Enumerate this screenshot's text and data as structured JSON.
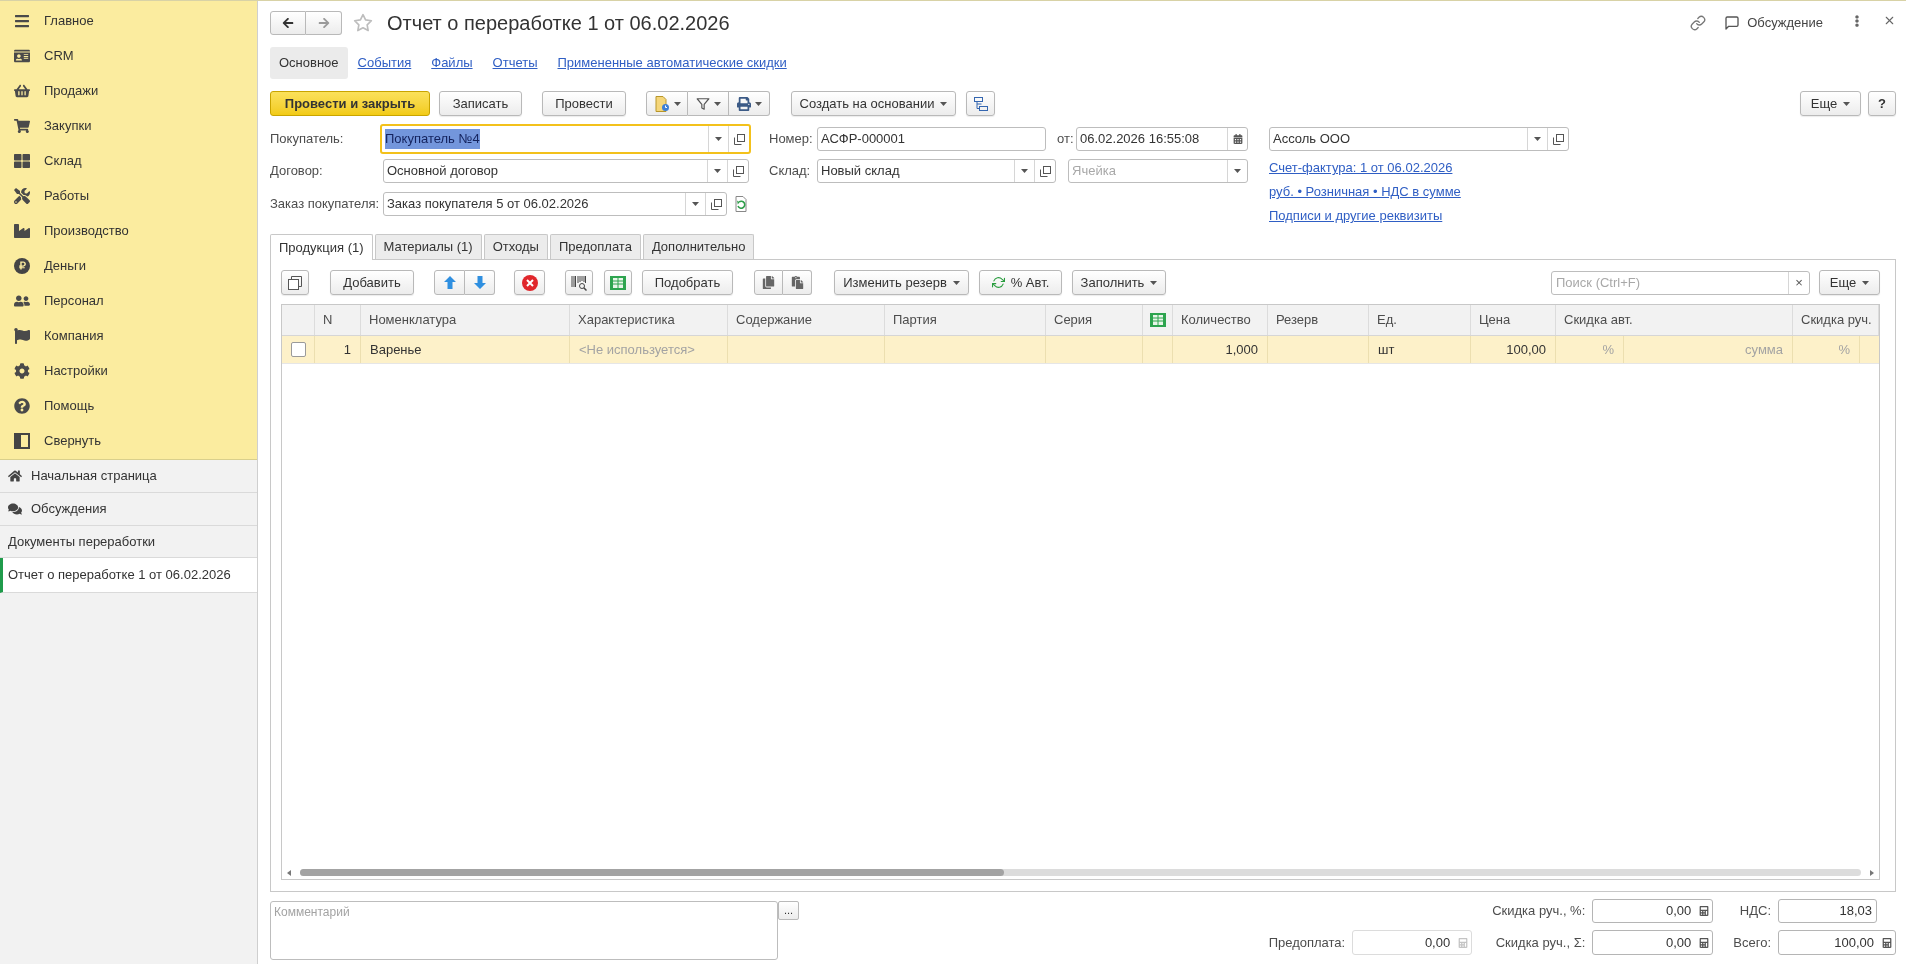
{
  "sidebar": {
    "sections": [
      {
        "label": "Главное"
      },
      {
        "label": "CRM"
      },
      {
        "label": "Продажи"
      },
      {
        "label": "Закупки"
      },
      {
        "label": "Склад"
      },
      {
        "label": "Работы"
      },
      {
        "label": "Производство"
      },
      {
        "label": "Деньги"
      },
      {
        "label": "Персонал"
      },
      {
        "label": "Компания"
      },
      {
        "label": "Настройки"
      },
      {
        "label": "Помощь"
      },
      {
        "label": "Свернуть"
      }
    ],
    "shortcuts": [
      {
        "label": "Начальная страница"
      },
      {
        "label": "Обсуждения"
      }
    ],
    "open_windows": {
      "title": "Документы переработки",
      "items": [
        {
          "label": "Отчет о переработке 1 от 06.02.2026",
          "selected": true
        }
      ]
    }
  },
  "window": {
    "title": "Отчет о переработке 1 от 06.02.2026",
    "favorite": false,
    "discussion": "Обсуждение"
  },
  "form_tabs": [
    {
      "label": "Основное",
      "selected": true
    },
    {
      "label": "События",
      "selected": false
    },
    {
      "label": "Файлы",
      "selected": false
    },
    {
      "label": "Отчеты",
      "selected": false
    },
    {
      "label": "Примененные автоматические скидки",
      "selected": false
    }
  ],
  "toolbar": {
    "post_and_close": "Провести и закрыть",
    "save": "Записать",
    "post": "Провести",
    "create_based_on": "Создать на основании",
    "more": "Еще",
    "help": "?"
  },
  "header_fields": {
    "buyer": {
      "label": "Покупатель:",
      "value": "Покупатель №4",
      "focused": true
    },
    "contract": {
      "label": "Договор:",
      "value": "Основной договор",
      "focused": false
    },
    "customer_order": {
      "label": "Заказ покупателя:",
      "value": "Заказ покупателя 5 от 06.02.2026",
      "focused": false
    },
    "number": {
      "label": "Номер:",
      "value": "АСФР-000001",
      "focused": false
    },
    "date": {
      "label": "от:",
      "value": "06.02.2026 16:55:08",
      "focused": false
    },
    "warehouse": {
      "label": "Склад:",
      "value": "Новый склад",
      "focused": false
    },
    "cell": {
      "placeholder": "Ячейка",
      "focused": false
    },
    "organization": {
      "value": "Ассоль ООО",
      "focused": false
    }
  },
  "links": [
    {
      "text": "Счет-фактура: 1 от 06.02.2026"
    },
    {
      "text": "руб. • Розничная • НДС в сумме"
    },
    {
      "text": "Подписи и другие реквизиты"
    }
  ],
  "table_tabs": [
    {
      "label": "Продукция (1)",
      "selected": true
    },
    {
      "label": "Материалы (1)",
      "selected": false
    },
    {
      "label": "Отходы",
      "selected": false
    },
    {
      "label": "Предоплата",
      "selected": false
    },
    {
      "label": "Дополнительно",
      "selected": false
    }
  ],
  "table_toolbar": {
    "add": "Добавить",
    "pick": "Подобрать",
    "change_reserve": "Изменить резерв",
    "auto_discounts": "% Авт.",
    "fill": "Заполнить",
    "search": {
      "placeholder": "Поиск (Ctrl+F)",
      "clear": "×"
    },
    "more": "Еще"
  },
  "table": {
    "columns": [
      {
        "kind": "check"
      },
      {
        "kind": "text",
        "label": "N"
      },
      {
        "kind": "text",
        "label": "Номенклатура"
      },
      {
        "kind": "text",
        "label": "Характеристика"
      },
      {
        "kind": "text",
        "label": "Содержание"
      },
      {
        "kind": "text",
        "label": "Партия"
      },
      {
        "kind": "text",
        "label": "Серия"
      },
      {
        "kind": "icon"
      },
      {
        "kind": "text",
        "label": "Количество"
      },
      {
        "kind": "text",
        "label": "Резерв"
      },
      {
        "kind": "text",
        "label": "Ед."
      },
      {
        "kind": "text",
        "label": "Цена"
      },
      {
        "kind": "text",
        "label": "Скидка авт."
      },
      {
        "kind": "text",
        "label": "Скидка руч."
      }
    ],
    "rows": [
      {
        "selected": true,
        "checked": false,
        "n": "1",
        "item": "Варенье",
        "characteristic": "<Не используется>",
        "quantity": "1,000",
        "unit": "шт",
        "price": "100,00",
        "auto_discount_percent": "%",
        "auto_discount_amount": "сумма",
        "manual_discount_percent": "%"
      }
    ]
  },
  "footer": {
    "comment": {
      "placeholder": "Комментарий",
      "more": "..."
    },
    "totals": [
      {
        "label": "Скидка руч., %:",
        "value": "0,00",
        "kind": "input",
        "disabled": false
      },
      {
        "label": "НДС:",
        "value": "18,03",
        "kind": "readonly",
        "disabled": false
      },
      {
        "label": "Предоплата:",
        "value": "0,00",
        "kind": "input",
        "disabled": true
      },
      {
        "label": "Скидка руч., Σ:",
        "value": "0,00",
        "kind": "input",
        "disabled": false
      },
      {
        "label": "Всего:",
        "value": "100,00",
        "kind": "input",
        "disabled": false
      }
    ]
  }
}
